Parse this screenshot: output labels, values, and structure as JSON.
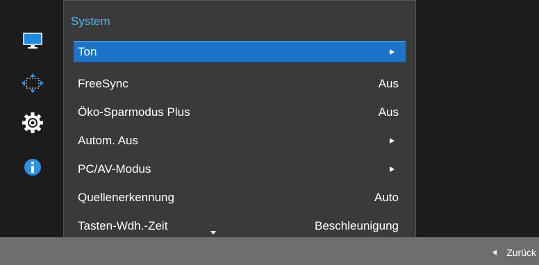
{
  "panel": {
    "title": "System"
  },
  "left_icons": [
    "monitor-icon",
    "resize-arrows-icon",
    "gear-icon",
    "info-icon"
  ],
  "menu_items": [
    {
      "label": "Ton",
      "value": "",
      "arrow": true,
      "selected": true
    },
    {
      "label": "FreeSync",
      "value": "Aus",
      "arrow": false
    },
    {
      "label": "Öko-Sparmodus Plus",
      "value": "Aus",
      "arrow": false
    },
    {
      "label": "Autom. Aus",
      "value": "",
      "arrow": true
    },
    {
      "label": "PC/AV-Modus",
      "value": "",
      "arrow": true
    },
    {
      "label": "Quellenerkennung",
      "value": "Auto",
      "arrow": false
    },
    {
      "label": "Tasten-Wdh.-Zeit",
      "value": "Beschleunigung",
      "arrow": false
    }
  ],
  "footer": {
    "back_label": "Zurück"
  },
  "colors": {
    "accent": "#1d73c8",
    "title": "#55b6ef"
  }
}
